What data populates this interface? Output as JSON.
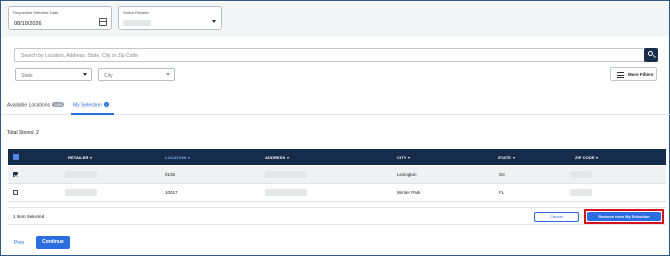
{
  "filters": {
    "effective_date_label": "Requested Effective Date",
    "effective_date_value": "08/10/2026",
    "retailer_label": "Select Retailer"
  },
  "search": {
    "placeholder": "Search by Location, Address, State, City or Zip Code"
  },
  "state_select": {
    "placeholder": "State"
  },
  "city_select": {
    "placeholder": "City"
  },
  "more_filters_label": "More Filters",
  "tabs": [
    {
      "label": "Available Locations",
      "badge": "1466"
    },
    {
      "label": "My Selection",
      "badge": "1"
    }
  ],
  "total_stores": "Total Stores: 2",
  "table": {
    "columns": [
      "RETAILER",
      "LOCATION",
      "ADDRESS",
      "CITY",
      "STATE",
      "ZIP CODE"
    ],
    "rows": [
      {
        "checked": true,
        "location": "0135",
        "city": "Lexington",
        "state": "SC"
      },
      {
        "checked": false,
        "location": "10017",
        "city": "Winter Park",
        "state": "FL"
      }
    ]
  },
  "footer": {
    "selected_count": "1 Item Selected",
    "cancel_label": "Cancel",
    "remove_label": "Remove from My Selection"
  },
  "nav": {
    "prev_label": "Prev",
    "continue_label": "Continue"
  },
  "colors": {
    "accent": "#2b6ce0",
    "header": "#162c4a",
    "highlight_outline": "#d4111f"
  }
}
